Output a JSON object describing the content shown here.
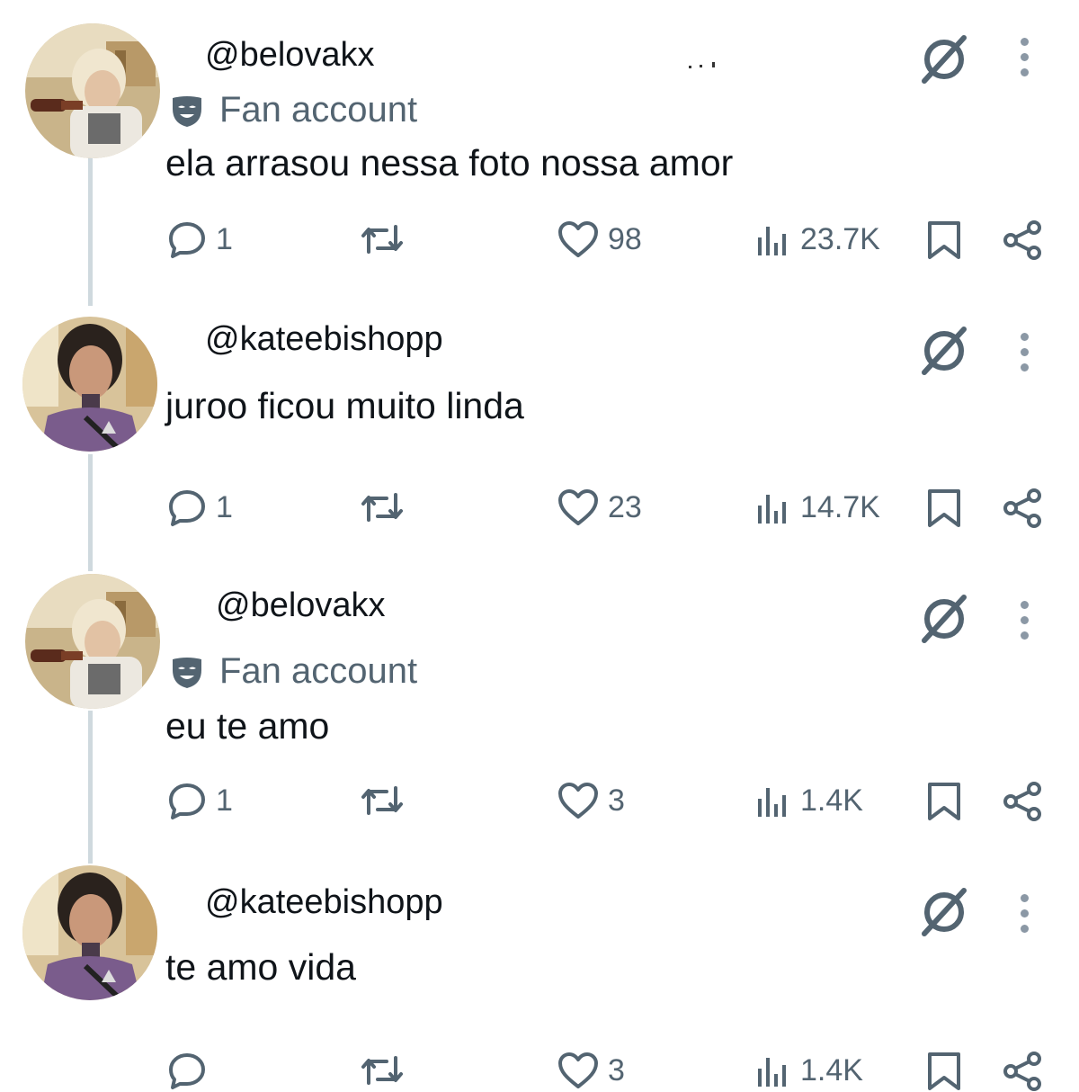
{
  "colors": {
    "text_primary": "#0f1419",
    "text_secondary": "#536471",
    "icon_gray": "#536471",
    "thread_line": "#cfd9de",
    "background": "#ffffff"
  },
  "posts": [
    {
      "handle": "@belovakx",
      "badge": "Fan account",
      "badge_icon": "mask-icon",
      "text": "ela arrasou nessa foto nossa amor",
      "replies": "1",
      "likes": "98",
      "views": "23.7K",
      "avatar": "avatar-belovakx"
    },
    {
      "handle": "@kateebishopp",
      "badge": null,
      "text": "juroo ficou muito linda",
      "replies": "1",
      "likes": "23",
      "views": "14.7K",
      "avatar": "avatar-kateebishopp"
    },
    {
      "handle": "@belovakx",
      "badge": "Fan account",
      "badge_icon": "mask-icon",
      "text": "eu te amo",
      "replies": "1",
      "likes": "3",
      "views": "1.4K",
      "avatar": "avatar-belovakx"
    },
    {
      "handle": "@kateebishopp",
      "badge": null,
      "text": "te amo vida",
      "replies": "",
      "likes": "3",
      "views": "1.4K",
      "avatar": "avatar-kateebishopp"
    }
  ]
}
